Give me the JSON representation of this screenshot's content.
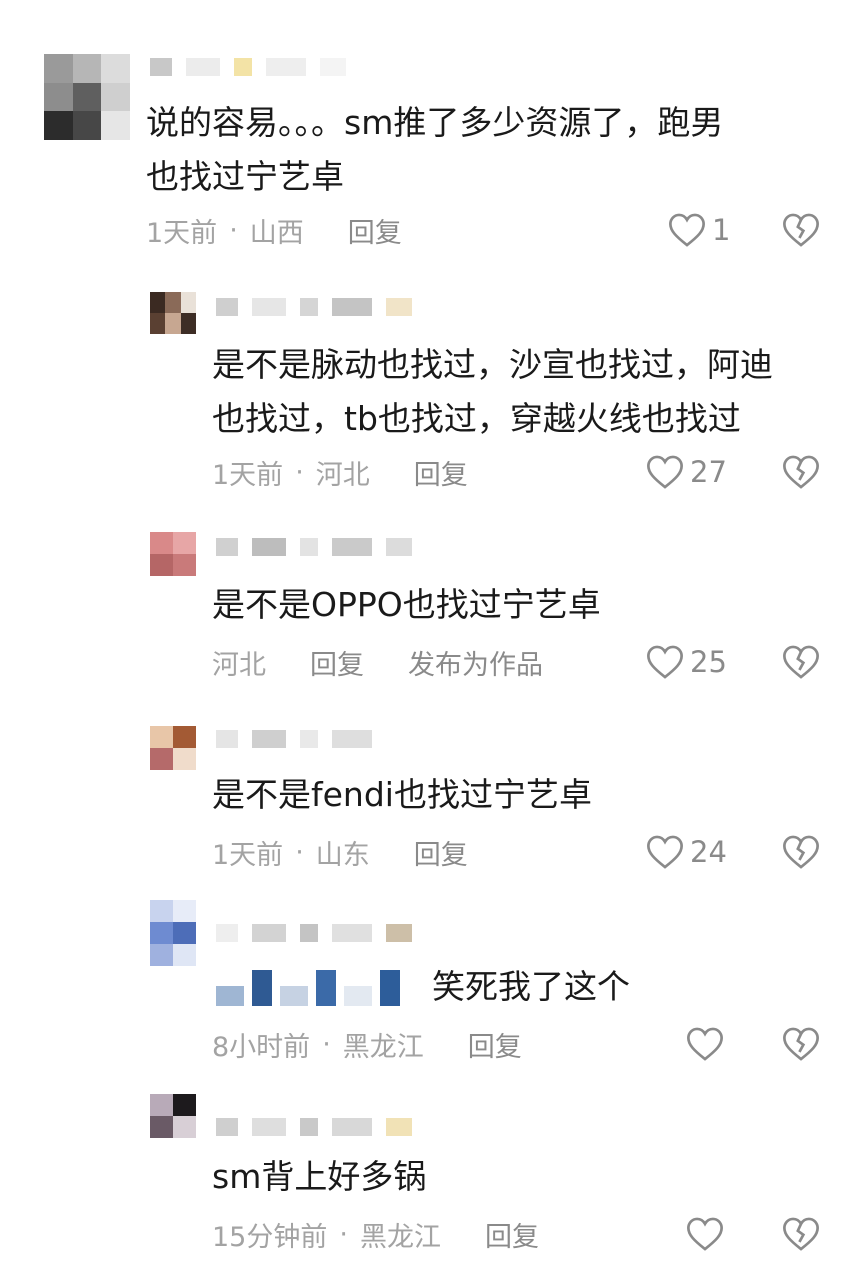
{
  "comments": [
    {
      "text_lines": [
        "说的容易。。。sm推了多少资源了，跑男",
        "也找过宁艺卓"
      ],
      "time": "1天前",
      "location": "山西",
      "reply": "回复",
      "likes": "1",
      "avatar_colors": [
        "#9a9a9a",
        "#b6b6b6",
        "#dcdcdc",
        "#8d8d8d",
        "#5f5f5f",
        "#cfcfcf",
        "#2c2c2c",
        "#474747",
        "#e6e6e6"
      ],
      "name_colors": [
        "#c8c8c8",
        "#ececec",
        "#f3e3a6",
        "#eeeeee",
        "#f4f4f4"
      ]
    },
    {
      "text_lines": [
        "是不是脉动也找过，沙宣也找过，阿迪",
        "也找过，tb也找过，穿越火线也找过"
      ],
      "time": "1天前",
      "location": "河北",
      "reply": "回复",
      "likes": "27",
      "avatar_colors": [
        "#3b2a22",
        "#8a6a58",
        "#e9e1d8",
        "#5a4032",
        "#c7a791",
        "#3d2d25"
      ],
      "name_colors": [
        "#cfcfcf",
        "#e6e6e6",
        "#d5d5d5",
        "#c4c4c4",
        "#f1e4c8"
      ]
    },
    {
      "text_lines": [
        "是不是OPPO也找过宁艺卓"
      ],
      "location": "河北",
      "reply": "回复",
      "publish": "发布为作品",
      "likes": "25",
      "avatar_colors": [
        "#d98989",
        "#e7a6a6",
        "#b56666",
        "#c97a7a"
      ],
      "name_colors": [
        "#d0d0d0",
        "#bdbdbd",
        "#e3e3e3",
        "#cacaca",
        "#dcdcdc"
      ]
    },
    {
      "text_lines": [
        "是不是fendi也找过宁艺卓"
      ],
      "time": "1天前",
      "location": "山东",
      "reply": "回复",
      "likes": "24",
      "avatar_colors": [
        "#e8c6a8",
        "#a35a34",
        "#b56a6a",
        "#f0dccb"
      ],
      "name_colors": [
        "#e5e5e5",
        "#cfcfcf",
        "#e9e9e9",
        "#dedede"
      ]
    },
    {
      "text_lines": [
        "笑死我了这个"
      ],
      "time": "8小时前",
      "location": "黑龙江",
      "reply": "回复",
      "likes": "",
      "avatar_colors": [
        "#c8d3ee",
        "#e7ecf8",
        "#6e8bd1",
        "#4d6db8",
        "#9fb1df",
        "#dfe6f5"
      ],
      "name_colors": [
        "#eeeeee",
        "#d3d3d3",
        "#c4c4c4",
        "#e0e0e0",
        "#cdbfa8"
      ],
      "emoji_colors": [
        "#9fb6d3",
        "#2f5a93",
        "#c6d2e3",
        "#3b6aa8",
        "#e3e9f1",
        "#2d5d9a"
      ]
    },
    {
      "text_lines": [
        "sm背上好多锅"
      ],
      "time": "15分钟前",
      "location": "黑龙江",
      "reply": "回复",
      "likes": "",
      "avatar_colors": [
        "#b8aab8",
        "#1d1a1d",
        "#6a5a66",
        "#d8cfd6"
      ],
      "name_colors": [
        "#cfcfcf",
        "#dedede",
        "#c9c9c9",
        "#d8d8d8",
        "#f1e2b6"
      ]
    }
  ]
}
